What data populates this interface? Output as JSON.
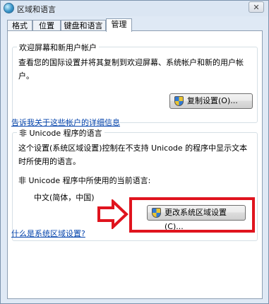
{
  "window": {
    "title": "区域和语言",
    "close_glyph": "✕"
  },
  "tabs": [
    {
      "label": "格式"
    },
    {
      "label": "位置"
    },
    {
      "label": "键盘和语言"
    },
    {
      "label": "管理"
    }
  ],
  "welcome_group": {
    "title": "欢迎屏幕和新用户帐户",
    "description": "查看您的国际设置并将其复制到欢迎屏幕、系统帐户和新的用户帐户。",
    "copy_button": "复制设置(O)...",
    "link": "告诉我关于这些帐户的详细信息"
  },
  "unicode_group": {
    "title": "非 Unicode 程序的语言",
    "description": "这个设置(系统区域设置)控制在不支持 Unicode 的程序中显示文本时所使用的语言。",
    "current_label": "非 Unicode 程序中所使用的当前语言:",
    "current_value": "中文(简体，中国)",
    "change_button": "更改系统区域设置(C)...",
    "link": "什么是系统区域设置?"
  },
  "annotation": {
    "arrow_color": "#e0141e",
    "box_color": "#e0141e"
  },
  "icons": {
    "title": "globe-icon",
    "buttons": "uac-shield-icon"
  }
}
